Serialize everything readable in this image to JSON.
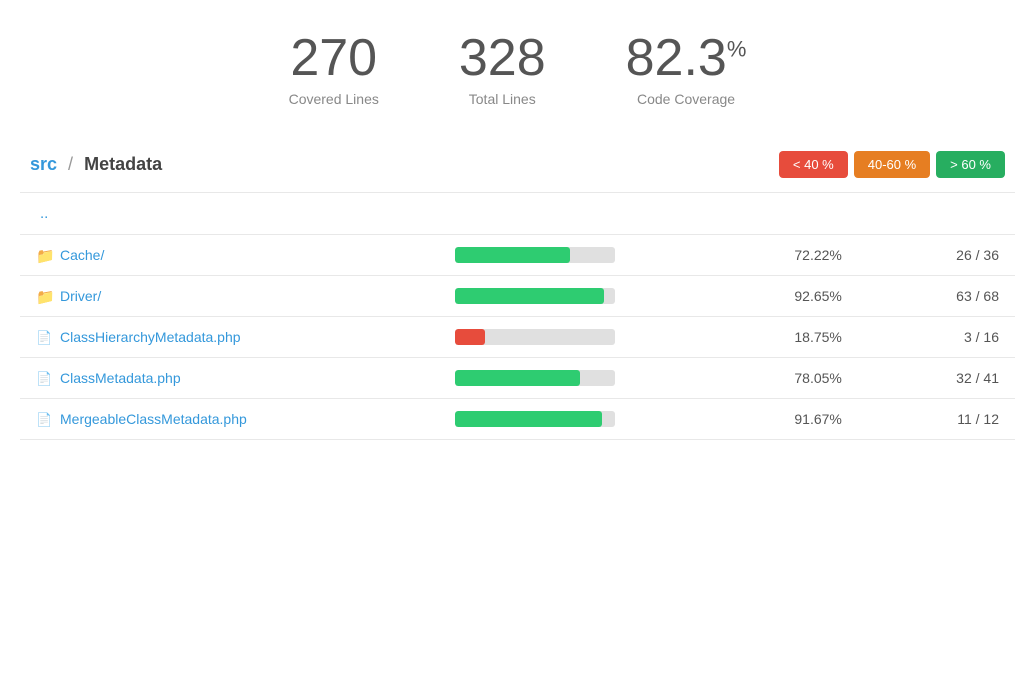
{
  "stats": {
    "covered_lines_value": "270",
    "covered_lines_label": "Covered Lines",
    "total_lines_value": "328",
    "total_lines_label": "Total Lines",
    "coverage_value": "82.3",
    "coverage_unit": "%",
    "coverage_label": "Code Coverage"
  },
  "breadcrumb": {
    "link_text": "src",
    "separator": "/",
    "current": "Metadata"
  },
  "legend": {
    "low_label": "< 40 %",
    "mid_label": "40-60 %",
    "high_label": "> 60 %"
  },
  "table": {
    "rows": [
      {
        "type": "parent",
        "name": "..",
        "href": "#",
        "pct": "",
        "ratio": "",
        "bar_pct": 0,
        "bar_color": ""
      },
      {
        "type": "folder",
        "name": "Cache/",
        "href": "#",
        "pct": "72.22%",
        "ratio": "26 / 36",
        "bar_pct": 72,
        "bar_color": "green"
      },
      {
        "type": "folder",
        "name": "Driver/",
        "href": "#",
        "pct": "92.65%",
        "ratio": "63 / 68",
        "bar_pct": 93,
        "bar_color": "green"
      },
      {
        "type": "file",
        "name": "ClassHierarchyMetadata.php",
        "href": "#",
        "pct": "18.75%",
        "ratio": "3 / 16",
        "bar_pct": 19,
        "bar_color": "red"
      },
      {
        "type": "file",
        "name": "ClassMetadata.php",
        "href": "#",
        "pct": "78.05%",
        "ratio": "32 / 41",
        "bar_pct": 78,
        "bar_color": "green"
      },
      {
        "type": "file",
        "name": "MergeableClassMetadata.php",
        "href": "#",
        "pct": "91.67%",
        "ratio": "11 / 12",
        "bar_pct": 92,
        "bar_color": "green"
      }
    ]
  }
}
